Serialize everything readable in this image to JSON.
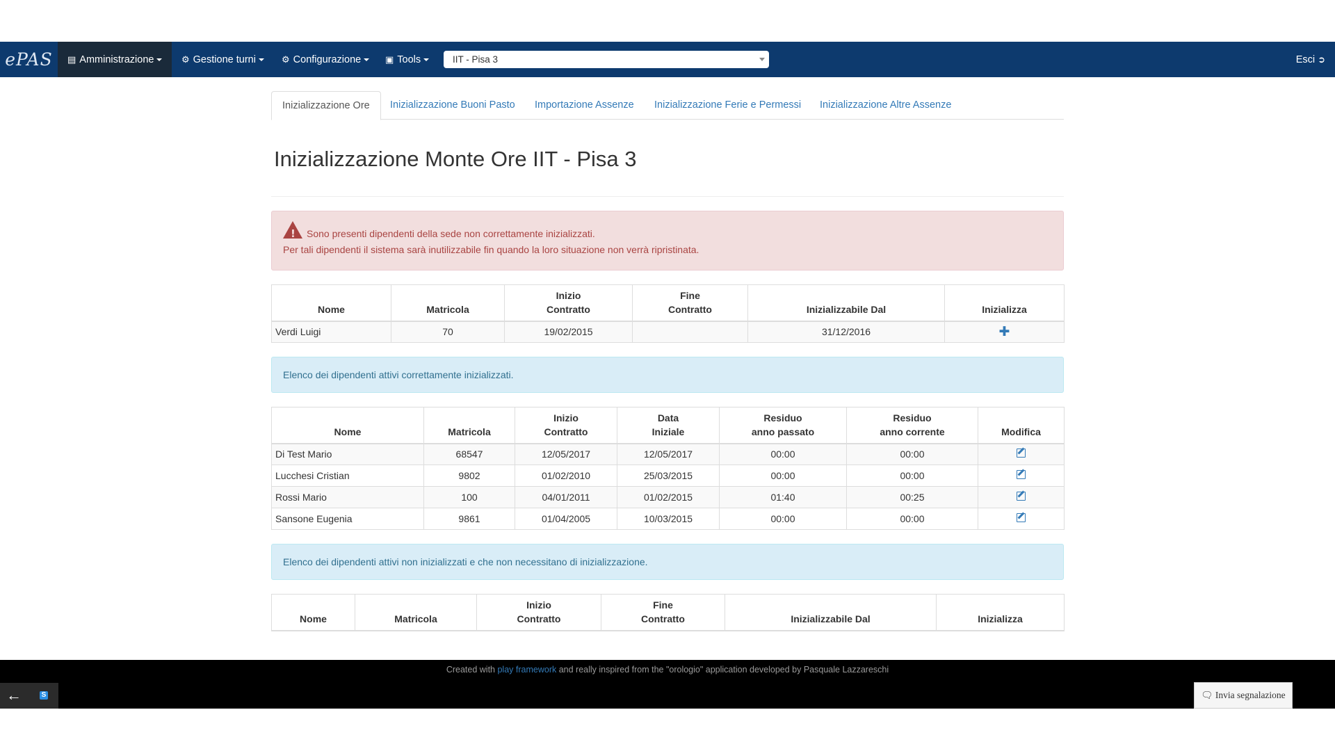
{
  "navbar": {
    "brand": "ePAS",
    "menus": [
      {
        "label": "Amministrazione",
        "icon": "bar-chart-icon",
        "active": true
      },
      {
        "label": "Gestione turni",
        "icon": "gear-icon",
        "active": false
      },
      {
        "label": "Configurazione",
        "icon": "gear-icon",
        "active": false
      },
      {
        "label": "Tools",
        "icon": "briefcase-icon",
        "active": false
      }
    ],
    "office_select": "IIT - Pisa 3",
    "logout": "Esci"
  },
  "tabs": [
    {
      "label": "Inizializzazione Ore",
      "active": true
    },
    {
      "label": "Inizializzazione Buoni Pasto",
      "active": false
    },
    {
      "label": "Importazione Assenze",
      "active": false
    },
    {
      "label": "Inizializzazione Ferie e Permessi",
      "active": false
    },
    {
      "label": "Inizializzazione Altre Assenze",
      "active": false
    }
  ],
  "page_title": "Inizializzazione Monte Ore IIT - Pisa 3",
  "alert_danger": {
    "line1": "Sono presenti dipendenti della sede non correttamente inizializzati.",
    "line2": "Per tali dipendenti il sistema sarà inutilizzabile fin quando la loro situazione non verrà ripristinata."
  },
  "table_uninitialized": {
    "headers": {
      "nome": "Nome",
      "matricola": "Matricola",
      "inizio_1": "Inizio",
      "inizio_2": "Contratto",
      "fine_1": "Fine",
      "fine_2": "Contratto",
      "dal": "Inizializzabile Dal",
      "inizializza": "Inizializza"
    },
    "rows": [
      {
        "nome": "Verdi Luigi",
        "matricola": "70",
        "inizio": "19/02/2015",
        "fine": "",
        "dal": "31/12/2016"
      }
    ]
  },
  "info_initialized": "Elenco dei dipendenti attivi correttamente inizializzati.",
  "table_initialized": {
    "headers": {
      "nome": "Nome",
      "matricola": "Matricola",
      "inizio_1": "Inizio",
      "inizio_2": "Contratto",
      "data_1": "Data",
      "data_2": "Iniziale",
      "res_passato_1": "Residuo",
      "res_passato_2": "anno passato",
      "res_corrente_1": "Residuo",
      "res_corrente_2": "anno corrente",
      "modifica": "Modifica"
    },
    "rows": [
      {
        "nome": "Di Test Mario",
        "matricola": "68547",
        "inizio": "12/05/2017",
        "data": "12/05/2017",
        "res_passato": "00:00",
        "res_corrente": "00:00"
      },
      {
        "nome": "Lucchesi Cristian",
        "matricola": "9802",
        "inizio": "01/02/2010",
        "data": "25/03/2015",
        "res_passato": "00:00",
        "res_corrente": "00:00"
      },
      {
        "nome": "Rossi Mario",
        "matricola": "100",
        "inizio": "04/01/2011",
        "data": "01/02/2015",
        "res_passato": "01:40",
        "res_corrente": "00:25"
      },
      {
        "nome": "Sansone Eugenia",
        "matricola": "9861",
        "inizio": "01/04/2005",
        "data": "10/03/2015",
        "res_passato": "00:00",
        "res_corrente": "00:00"
      }
    ]
  },
  "info_not_needed": "Elenco dei dipendenti attivi non inizializzati e che non necessitano di inizializzazione.",
  "table_not_needed": {
    "headers": {
      "nome": "Nome",
      "matricola": "Matricola",
      "inizio_1": "Inizio",
      "inizio_2": "Contratto",
      "fine_1": "Fine",
      "fine_2": "Contratto",
      "dal": "Inizializzabile Dal",
      "inizializza": "Inizializza"
    }
  },
  "footer": {
    "prefix": "Created with ",
    "link": "play framework",
    "suffix": " and really inspired from the \"orologio\" application developed by Pasquale Lazzareschi"
  },
  "report_button": "Invia segnalazione"
}
